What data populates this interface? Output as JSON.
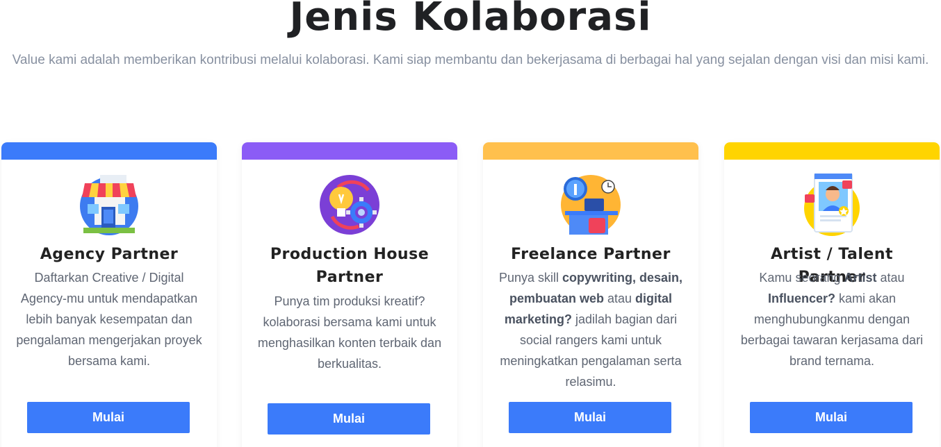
{
  "header": {
    "title": "Jenis Kolaborasi",
    "subtitle": "Value kami adalah memberikan kontribusi melalui kolaborasi. Kami siap membantu dan bekerjasama di berbagai hal yang sejalan dengan visi dan misi kami."
  },
  "cards": [
    {
      "title": "Agency Partner",
      "accent": "#3b7bfa",
      "icon": "storefront-icon",
      "desc": [
        {
          "t": "Daftarkan Creative / Digital Agency-mu untuk mendapatkan lebih banyak kesempatan dan pengalaman mengerjakan proyek bersama kami.",
          "b": false
        }
      ],
      "button": "Mulai"
    },
    {
      "title": "Production House Partner",
      "accent": "#8b5cf6",
      "icon": "idea-gear-icon",
      "desc": [
        {
          "t": "Punya tim produksi kreatif? kolaborasi bersama kami untuk menghasilkan konten terbaik dan berkualitas.",
          "b": false
        }
      ],
      "button": "Mulai"
    },
    {
      "title": "Freelance Partner",
      "accent": "#ffc04d",
      "icon": "workspace-icon",
      "desc": [
        {
          "t": "Punya skill ",
          "b": false
        },
        {
          "t": "copywriting, desain, pembuatan web",
          "b": true
        },
        {
          "t": " atau ",
          "b": false
        },
        {
          "t": "digital marketing?",
          "b": true
        },
        {
          "t": " jadilah bagian dari social rangers kami untuk meningkatkan pengalaman serta relasimu.",
          "b": false
        }
      ],
      "button": "Mulai"
    },
    {
      "title": "Artist / Talent Partner",
      "accent": "#ffd400",
      "icon": "influencer-icon",
      "desc": [
        {
          "t": "Kamu seorang ",
          "b": false
        },
        {
          "t": "Artist",
          "b": true
        },
        {
          "t": " atau ",
          "b": false
        },
        {
          "t": "Influencer?",
          "b": true
        },
        {
          "t": " kami akan menghubungkanmu dengan berbagai tawaran kerjasama dari brand ternama.",
          "b": false
        }
      ],
      "button": "Mulai"
    }
  ]
}
